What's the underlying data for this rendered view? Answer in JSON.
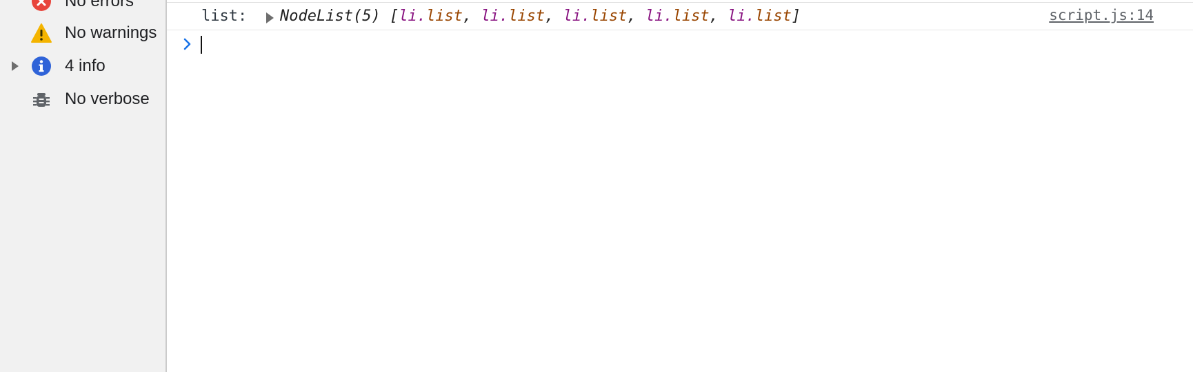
{
  "sidebar": {
    "items": [
      {
        "label": "No errors",
        "icon": "error-icon",
        "color": "#e8453c",
        "expandable": false
      },
      {
        "label": "No warnings",
        "icon": "warning-icon",
        "color": "#f4b400",
        "expandable": false
      },
      {
        "label": "4 info",
        "icon": "info-icon",
        "color": "#2f63d8",
        "expandable": true
      },
      {
        "label": "No verbose",
        "icon": "bug-icon",
        "color": "#5f6368",
        "expandable": false
      }
    ]
  },
  "console": {
    "messages": [
      {
        "key": "list:",
        "value": {
          "type": "NodeList(5)",
          "open": "[",
          "close": "]",
          "separator": ",",
          "items": [
            {
              "tag": "li",
              "dot": ".",
              "cls": "list"
            },
            {
              "tag": "li",
              "dot": ".",
              "cls": "list"
            },
            {
              "tag": "li",
              "dot": ".",
              "cls": "list"
            },
            {
              "tag": "li",
              "dot": ".",
              "cls": "list"
            },
            {
              "tag": "li",
              "dot": ".",
              "cls": "list"
            }
          ]
        },
        "source": "script.js:14"
      }
    ],
    "prompt": {
      "value": "",
      "chevron_color": "#1a73e8"
    }
  }
}
